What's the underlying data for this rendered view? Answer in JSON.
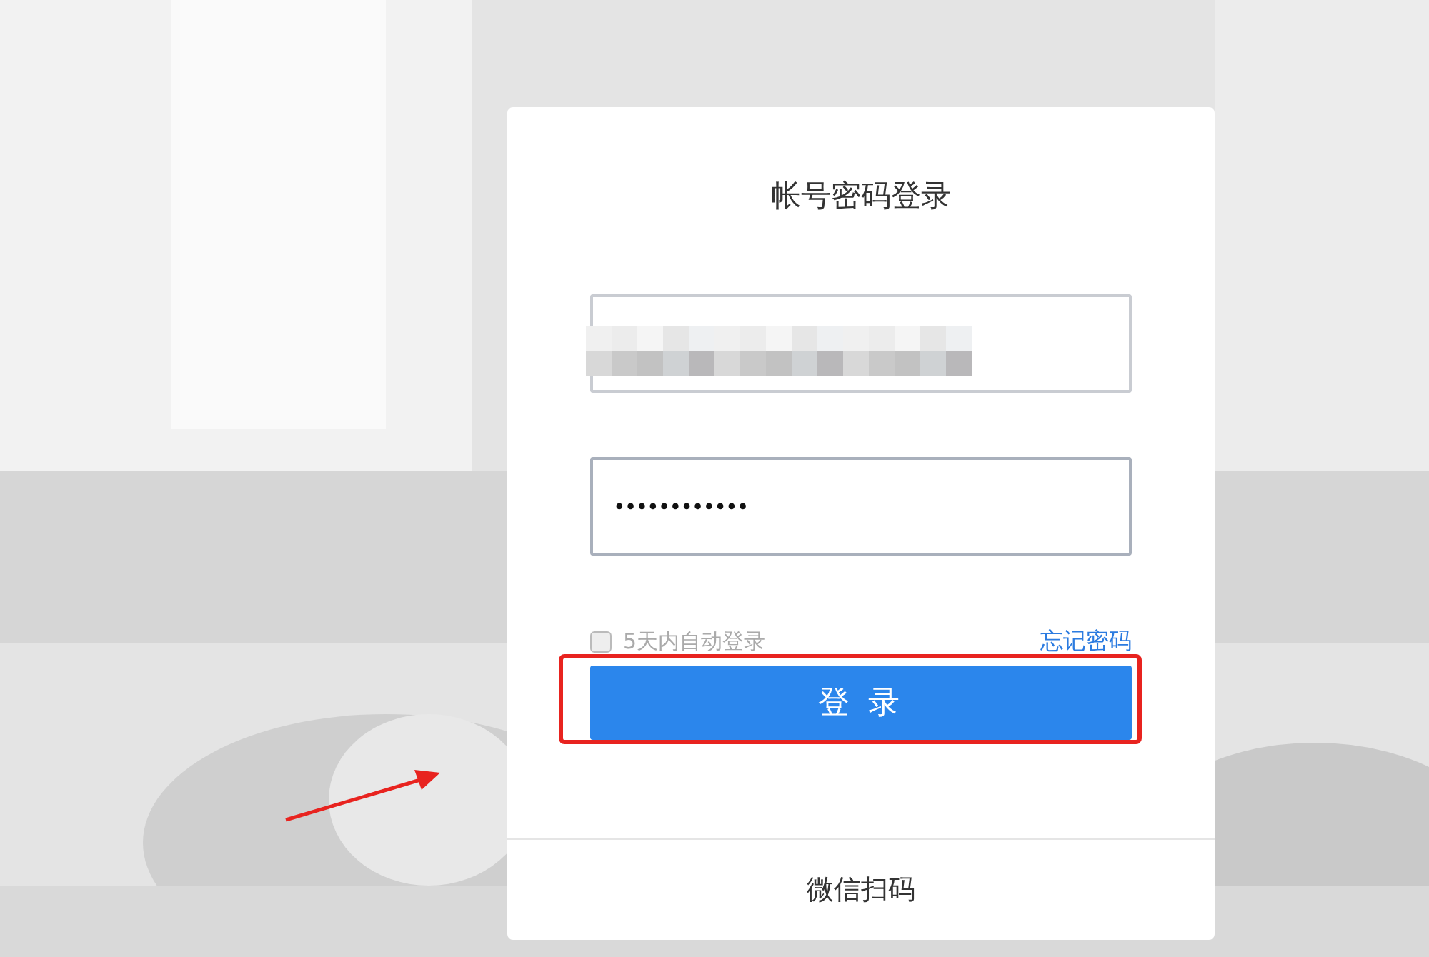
{
  "login_card": {
    "title": "帐号密码登录",
    "username_field": {
      "redacted": true
    },
    "password_field": {
      "value": "••••••••••••"
    },
    "remember": {
      "label": "5天内自动登录",
      "checked": false
    },
    "forgot_link": "忘记密码",
    "login_button": {
      "label": "登 录",
      "highlighted": true
    },
    "footer_tab": "微信扫码"
  },
  "annotation_arrow": {
    "shown": true
  }
}
